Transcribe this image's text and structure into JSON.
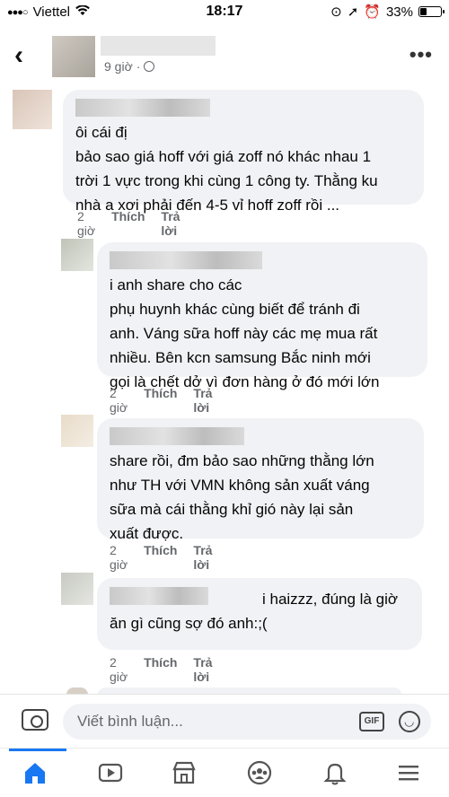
{
  "status_bar": {
    "carrier": "Viettel",
    "time": "18:17",
    "battery": "33%",
    "battery_level": 0.33
  },
  "header": {
    "post_time": "9 giờ"
  },
  "comments": [
    {
      "first_line": "ôi cái đị",
      "text": "bảo sao giá hoff với giá zoff nó khác nhau 1\ntrời 1 vực trong khi cùng 1 công ty. Thằng ku\nnhà a xơi phải đến 4-5 vỉ hoff zoff rồi ...",
      "time": "2 giờ",
      "like": "Thích",
      "reply": "Trả lời"
    },
    {
      "first_line": "i anh share cho các",
      "text": "phụ huynh khác cùng biết để tránh đi\nanh. Váng sữa hoff này các mẹ mua rất\nnhiều. Bên kcn samsung Bắc ninh mới\ngọi là chết dở vì đơn hàng ở đó mới lớn",
      "time": "2 giờ",
      "like": "Thích",
      "reply": "Trả lời"
    },
    {
      "first_line": "",
      "text": "share rồi, đm bảo sao những thằng lớn\nnhư TH với VMN không sản xuất váng\nsữa mà cái thằng khỉ gió này lại sản\nxuất được.",
      "time": "2 giờ",
      "like": "Thích",
      "reply": "Trả lời"
    },
    {
      "first_line": "i haizzz, đúng là giờ",
      "text": "ăn gì cũng sợ đó anh:;(",
      "time": "2 giờ",
      "like": "Thích",
      "reply": "Trả lời"
    }
  ],
  "composer": {
    "placeholder": "Viết bình luận...",
    "gif_label": "GIF"
  },
  "tabbar": {
    "items": [
      {
        "icon": "home-icon",
        "active": true
      },
      {
        "icon": "video-icon",
        "active": false
      },
      {
        "icon": "marketplace-icon",
        "active": false
      },
      {
        "icon": "groups-icon",
        "active": false
      },
      {
        "icon": "bell-icon",
        "active": false
      },
      {
        "icon": "menu-icon",
        "active": false
      }
    ]
  },
  "colors": {
    "accent": "#1877f2",
    "bubble": "#f0f2f5",
    "meta_text": "#65676b"
  }
}
